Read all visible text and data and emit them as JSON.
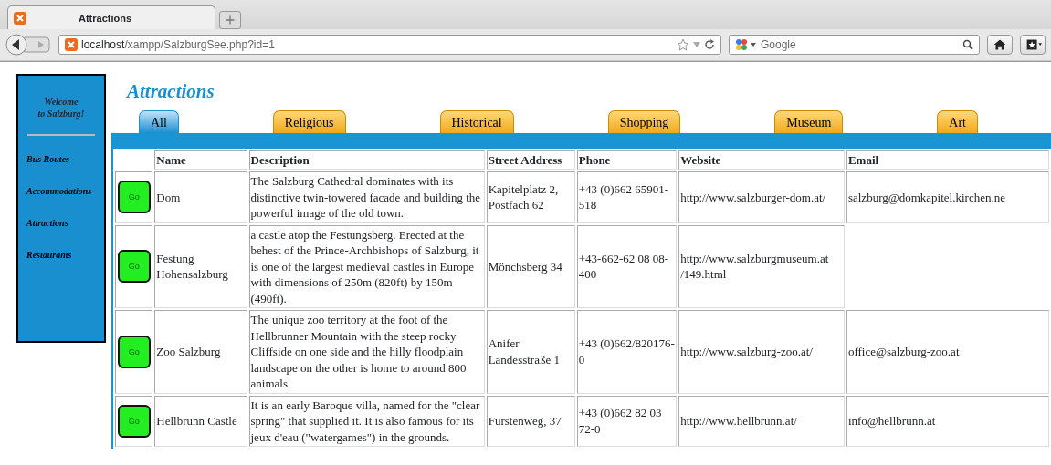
{
  "browser": {
    "tab_title": "Attractions",
    "url_host": "localhost",
    "url_path": "/xampp/SalzburgSee.php?id=1",
    "search_placeholder": "Google"
  },
  "sidebar": {
    "welcome": [
      "Welcome",
      "to Salzburg!"
    ],
    "items": [
      {
        "label": "Bus Routes"
      },
      {
        "label": "Accommodations"
      },
      {
        "label": "Attractions"
      },
      {
        "label": "Restaurants"
      }
    ]
  },
  "page_title": "Attractions",
  "tabs": [
    {
      "label": "All",
      "selected": true
    },
    {
      "label": "Religious",
      "selected": false
    },
    {
      "label": "Historical",
      "selected": false
    },
    {
      "label": "Shopping",
      "selected": false
    },
    {
      "label": "Museum",
      "selected": false
    },
    {
      "label": "Art",
      "selected": false
    }
  ],
  "table": {
    "columns": [
      "Name",
      "Description",
      "Street Address",
      "Phone",
      "Website",
      "Email"
    ],
    "rows": [
      {
        "button": "Go",
        "name": "Dom",
        "description": "The Salzburg Cathedral dominates with its distinctive twin-towered facade and building the powerful image of the old town.",
        "street_address": "Kapitelplatz 2, Postfach 62",
        "phone": "+43 (0)662 65901-518",
        "website": "http://www.salzburger-dom.at/",
        "email": "salzburg@domkapitel.kirchen.ne"
      },
      {
        "button": "Go",
        "name": "Festung Hohensalzburg",
        "description": "a castle atop the Festungsberg. Erected at the behest of the Prince-Archbishops of Salzburg, it is one of the largest medieval castles in Europe with dimensions of 250m (820ft) by 150m (490ft).",
        "street_address": "Mönchsberg 34",
        "phone": "+43-662-62 08 08-400",
        "website": "http://www.salzburgmuseum.at /149.html"
      },
      {
        "button": "Go",
        "name": "Zoo Salzburg",
        "description": "The unique zoo territory at the foot of the Hellbrunner Mountain with the steep rocky Cliffside on one side and the hilly floodplain landscape on the other is home to around 800 animals.",
        "street_address": "Anifer Landesstraße 1",
        "phone": "+43 (0)662/820176-0",
        "website": "http://www.salzburg-zoo.at/",
        "email": "office@salzburg-zoo.at"
      },
      {
        "button": "Go",
        "name": "Hellbrunn Castle",
        "description": "It is an early Baroque villa, named for the \"clear spring\" that supplied it. It is also famous for its jeux d'eau (\"watergames\") in the grounds.",
        "street_address": "Furstenweg, 37",
        "phone": "+43 (0)662 82 03 72-0",
        "website": "http://www.hellbrunn.at/",
        "email": "info@hellbrunn.at"
      }
    ]
  }
}
